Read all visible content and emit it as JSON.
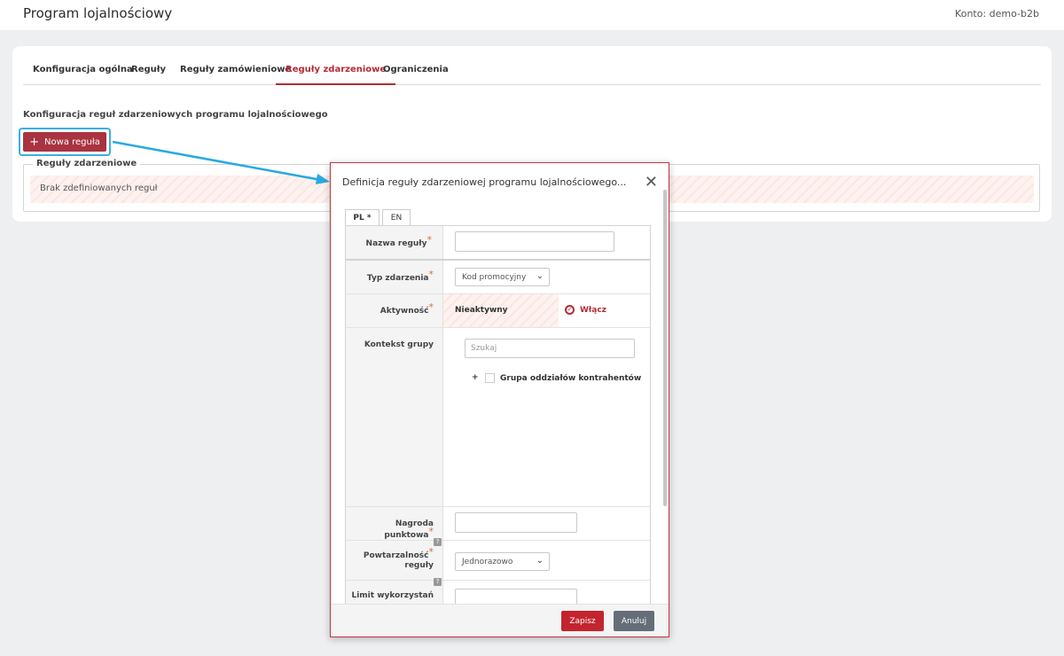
{
  "header": {
    "title": "Program lojalnościowy",
    "account": "Konto: demo-b2b"
  },
  "tabs": [
    {
      "label": "Konfiguracja ogólna"
    },
    {
      "label": "Reguły"
    },
    {
      "label": "Reguły zamówieniowe"
    },
    {
      "label": "Reguły zdarzeniowe",
      "active": true
    },
    {
      "label": "Ograniczenia"
    }
  ],
  "section": {
    "title": "Konfiguracja reguł zdarzeniowych programu lojalnościowego",
    "new_button": "Nowa reguła",
    "fieldset_legend": "Reguły zdarzeniowe",
    "empty_text": "Brak zdefiniowanych reguł"
  },
  "dialog": {
    "title": "Definicja reguły zdarzeniowej programu lojalnościowego...",
    "lang_tabs": [
      {
        "label": "PL *"
      },
      {
        "label": "EN"
      }
    ],
    "fields": {
      "name": {
        "label": "Nazwa reguły",
        "required": "*",
        "value": ""
      },
      "event_type": {
        "label": "Typ zdarzenia",
        "required": "*",
        "value": "Kod promocyjny"
      },
      "activity": {
        "label": "Aktywność",
        "required": "*",
        "value": "Nieaktywny",
        "action": "Włącz"
      },
      "group_context": {
        "label": "Kontekst grupy",
        "search_placeholder": "Szukaj",
        "tree_item": "Grupa oddziałów kontrahentów"
      },
      "points": {
        "label": "Nagroda punktowa",
        "required": "*",
        "value": ""
      },
      "repeat": {
        "label_line1": "Powtarzalność",
        "label_line2": "reguły",
        "required": "*",
        "value": "Jednorazowo"
      },
      "limit": {
        "label": "Limit wykorzystań"
      }
    },
    "help_symbol": "?",
    "save": "Zapisz",
    "cancel": "Anuluj"
  },
  "colors": {
    "accent": "#b52b35",
    "highlight": "#3bb0e3",
    "cancel": "#656d78"
  }
}
